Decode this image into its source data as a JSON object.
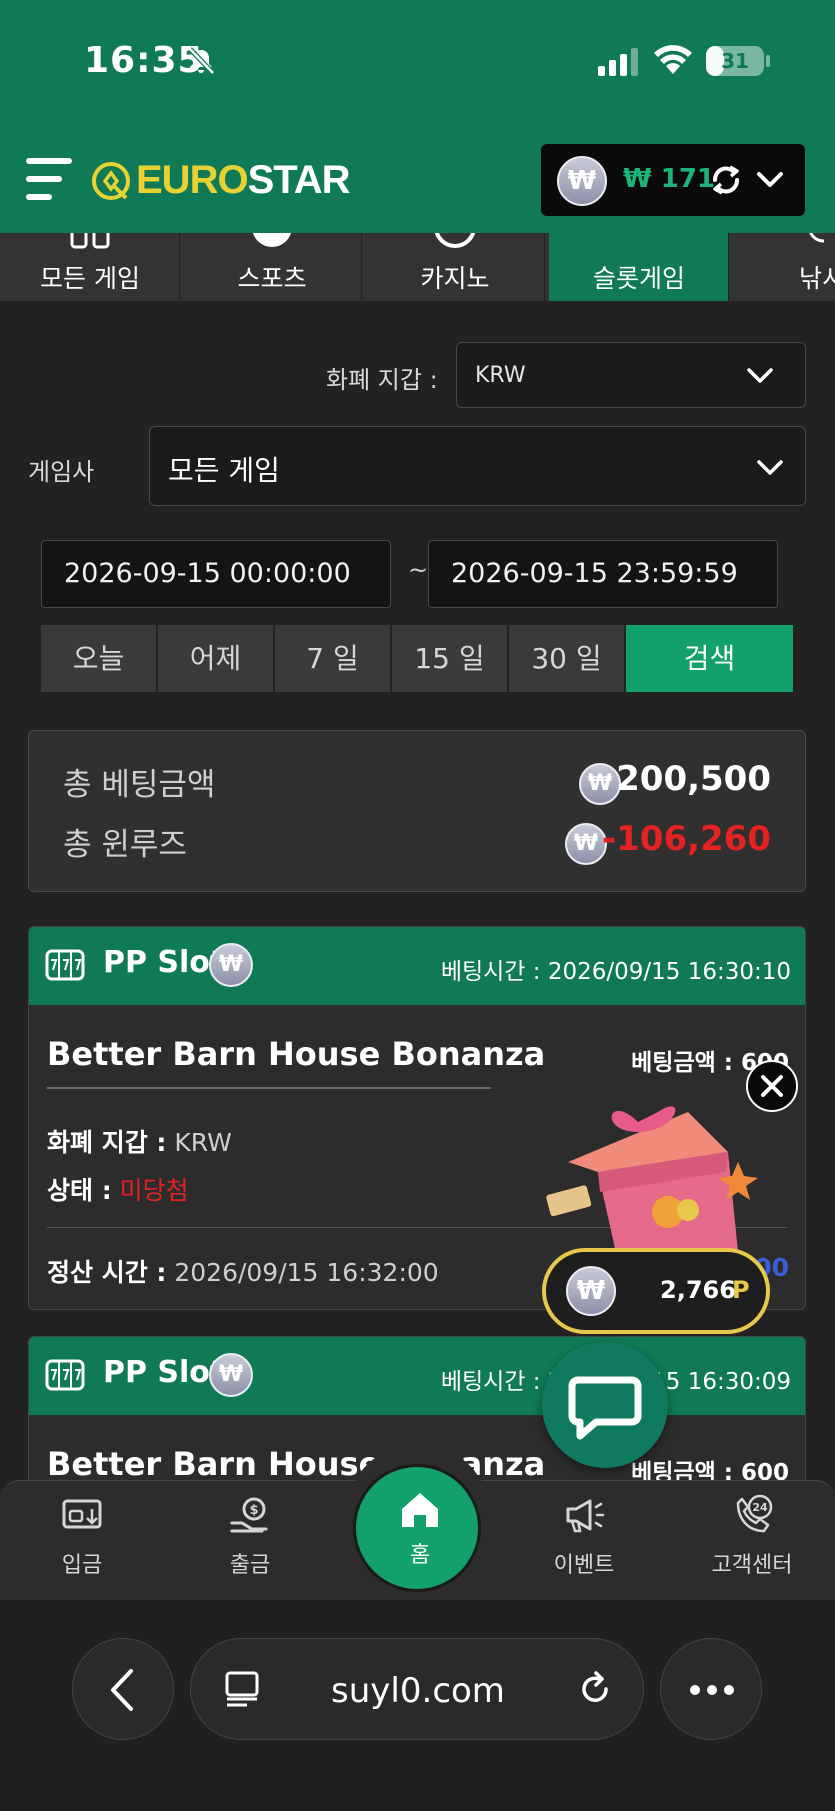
{
  "status_bar": {
    "time": "16:35",
    "battery": "31",
    "battery_level": 0.31
  },
  "header": {
    "logo_part1": "EURO",
    "logo_part2": "STAR",
    "wallet_symbol": "₩",
    "wallet_amount": "₩ 171"
  },
  "categories": [
    {
      "label": "모든 게임",
      "active": false
    },
    {
      "label": "스포츠",
      "active": false
    },
    {
      "label": "카지노",
      "active": false
    },
    {
      "label": "슬롯게임",
      "active": true
    },
    {
      "label": "낚시",
      "active": false
    }
  ],
  "filters": {
    "wallet_label": "화폐 지갑 :",
    "wallet_value": "KRW",
    "provider_label": "게임사",
    "provider_value": "모든 게임",
    "date_from": "2026-09-15 00:00:00",
    "date_sep": "~",
    "date_to": "2026-09-15 23:59:59",
    "quick_ranges": [
      "오늘",
      "어제",
      "7 일",
      "15 일",
      "30 일"
    ],
    "search_label": "검색"
  },
  "summary": {
    "total_bet_label": "총 베팅금액",
    "total_bet_value": "200,500",
    "total_winloss_label": "총 윈루즈",
    "total_winloss_value": "-106,260"
  },
  "bets": [
    {
      "provider": "PP Slot",
      "bet_time": "베팅시간 : 2026/09/15 16:30:10",
      "game": "Better Barn House Bonanza",
      "bet_amount": "베팅금액 : 600",
      "wallet_key": "화폐 지갑 :",
      "wallet_val": "KRW",
      "status_key": "상태 :",
      "status_val": "미당첨",
      "settle_key": "정산 시간 :",
      "settle_val": "2026/09/15 16:32:00",
      "payout_partial": "00"
    },
    {
      "provider": "PP Slot",
      "bet_time": "베팅시간 : 2026/09/15 16:30:09",
      "game": "Better Barn House Bonanza",
      "bet_amount": "베팅금액 : 600"
    }
  ],
  "points": {
    "value": "2,766",
    "unit": "P"
  },
  "bottom_nav": {
    "deposit": "입금",
    "withdraw": "출금",
    "home": "홈",
    "event": "이벤트",
    "support": "고객센터",
    "support_badge": "24"
  },
  "browser": {
    "url": "suyl0.com"
  },
  "colors": {
    "brand_green": "#0f7a55",
    "accent_green": "#12a06b",
    "logo_yellow": "#e8d233",
    "loss_red": "#e52222",
    "points_gold": "#e8c84a"
  }
}
